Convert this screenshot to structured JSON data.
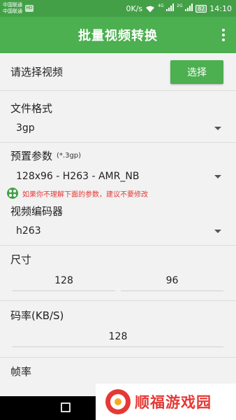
{
  "status_bar": {
    "carrier_1": "中国联通",
    "carrier_2": "中国联通",
    "carrier_badge": "HD",
    "speed": "0K/s",
    "net_4g": "4G",
    "net_2g": "2G",
    "battery": "82",
    "time": "14:10"
  },
  "toolbar": {
    "title": "批量视频转换"
  },
  "select_video": {
    "label": "请选择视频",
    "button_label": "选择"
  },
  "file_format": {
    "title": "文件格式",
    "value": "3gp"
  },
  "preset": {
    "title": "预置参数",
    "hint_ext": "(*.3gp)",
    "value": "128x96 - H263 - AMR_NB",
    "warning": "如果你不理解下面的参数，建议不要修改"
  },
  "video_encoder": {
    "title": "视频编码器",
    "value": "h263"
  },
  "size": {
    "title": "尺寸",
    "width": "128",
    "height": "96"
  },
  "bitrate": {
    "title": "码率(KB/S)",
    "value": "128"
  },
  "framerate": {
    "title": "帧率"
  },
  "watermark": {
    "text": "顺福游戏园"
  },
  "colors": {
    "primary": "#4caf50",
    "status_bar": "#43a047",
    "warning": "#e53935"
  }
}
